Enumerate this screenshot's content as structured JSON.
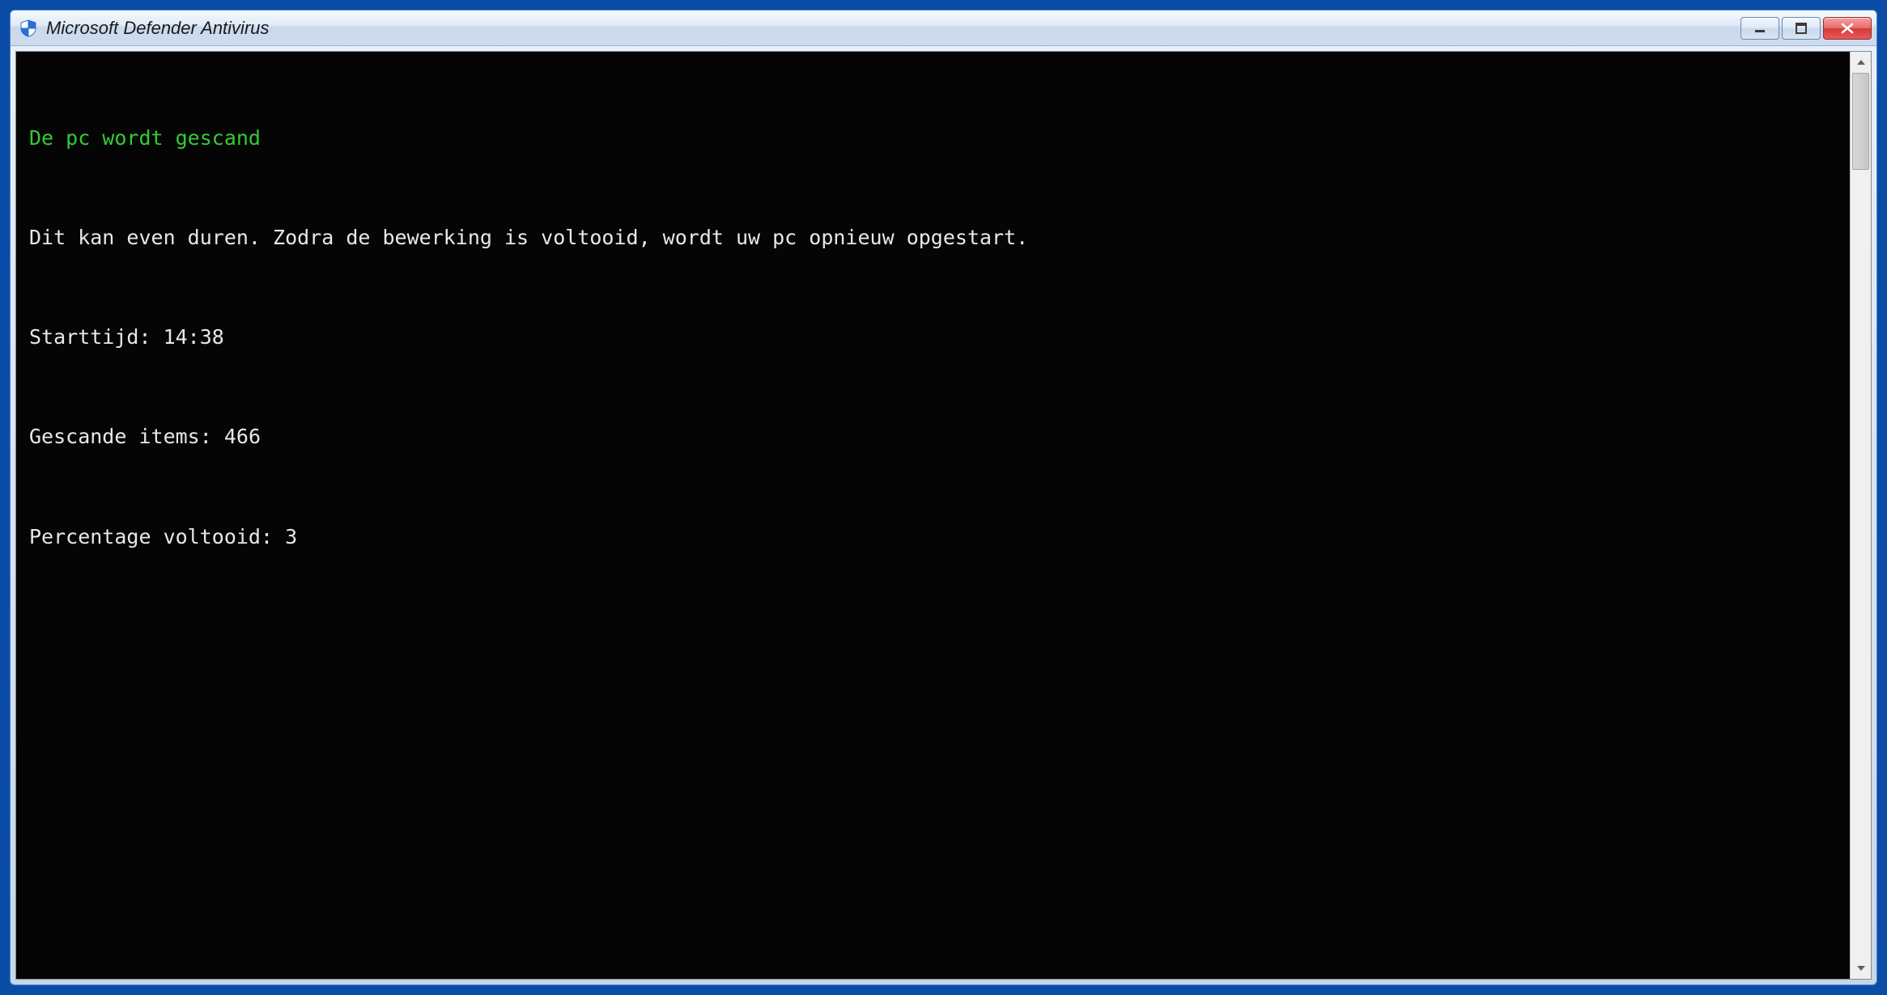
{
  "window": {
    "title": "Microsoft Defender Antivirus"
  },
  "console": {
    "heading": "De pc wordt gescand",
    "message": "Dit kan even duren. Zodra de bewerking is voltooid, wordt uw pc opnieuw opgestart.",
    "lines": {
      "start_time_label": "Starttijd:",
      "start_time_value": "14:38",
      "scanned_label": "Gescande items:",
      "scanned_value": "466",
      "percent_label": "Percentage voltooid:",
      "percent_value": "3"
    }
  },
  "colors": {
    "frame_blue": "#0a4da8",
    "console_green": "#33cc33",
    "console_fg": "#e8e8e8",
    "console_bg": "#050505"
  }
}
